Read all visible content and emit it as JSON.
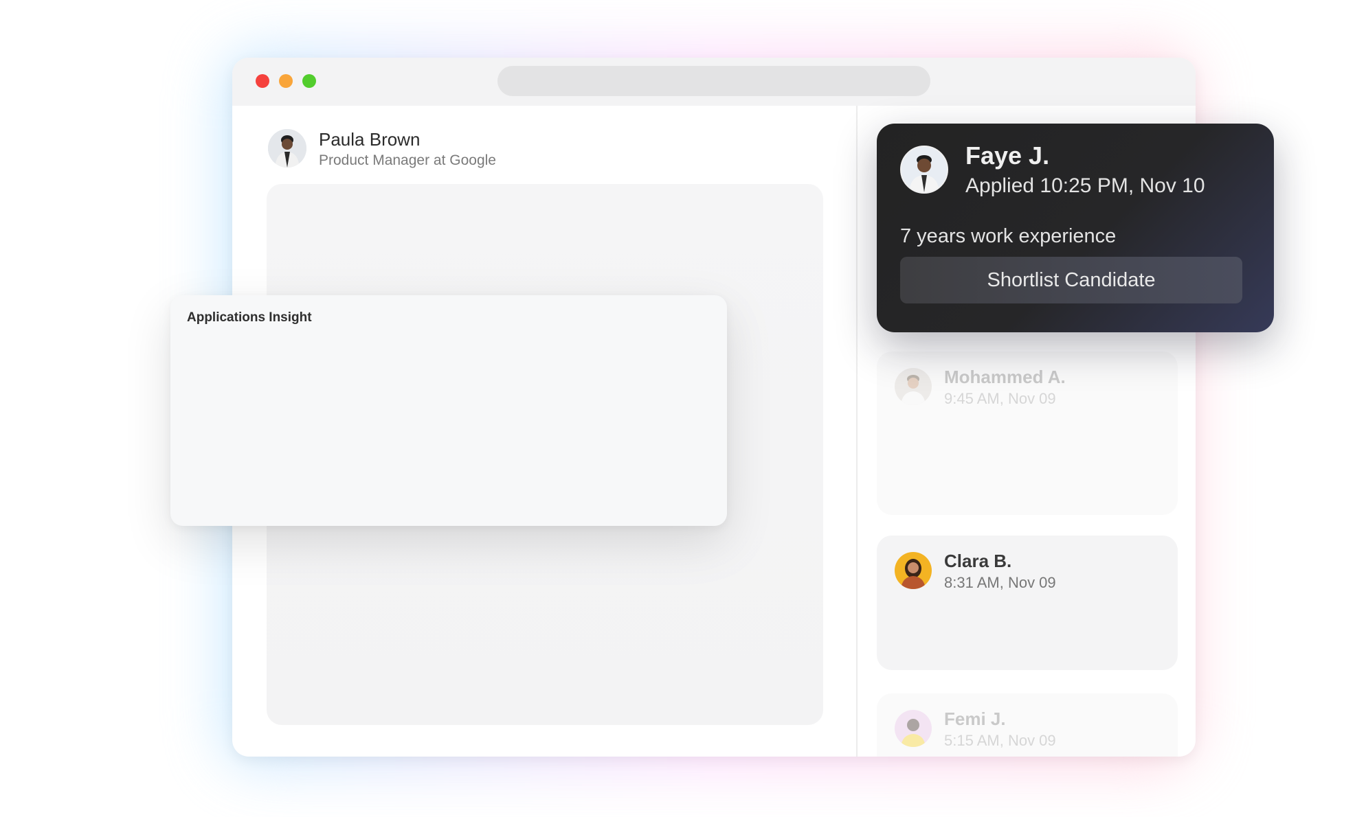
{
  "profile": {
    "name": "Paula Brown",
    "role": "Product Manager at Google"
  },
  "insight": {
    "title": "Applications Insight"
  },
  "featured_candidate": {
    "name": "Faye J.",
    "applied": "Applied 10:25 PM, Nov 10",
    "experience": "7 years work experience",
    "action_label": "Shortlist Candidate"
  },
  "candidates": [
    {
      "name": "Mohammed A.",
      "time": "9:45 AM, Nov 09"
    },
    {
      "name": "Clara B.",
      "time": "8:31 AM, Nov 09"
    },
    {
      "name": "Femi J.",
      "time": "5:15 AM, Nov 09"
    }
  ],
  "colors": {
    "window_close": "#f5413d",
    "window_minimize": "#f9a53a",
    "window_maximize": "#52cd2d",
    "featured_bg": "#232323",
    "clara_avatar_bg": "#f3b323",
    "femi_avatar_bg": "#e6c4e6"
  }
}
